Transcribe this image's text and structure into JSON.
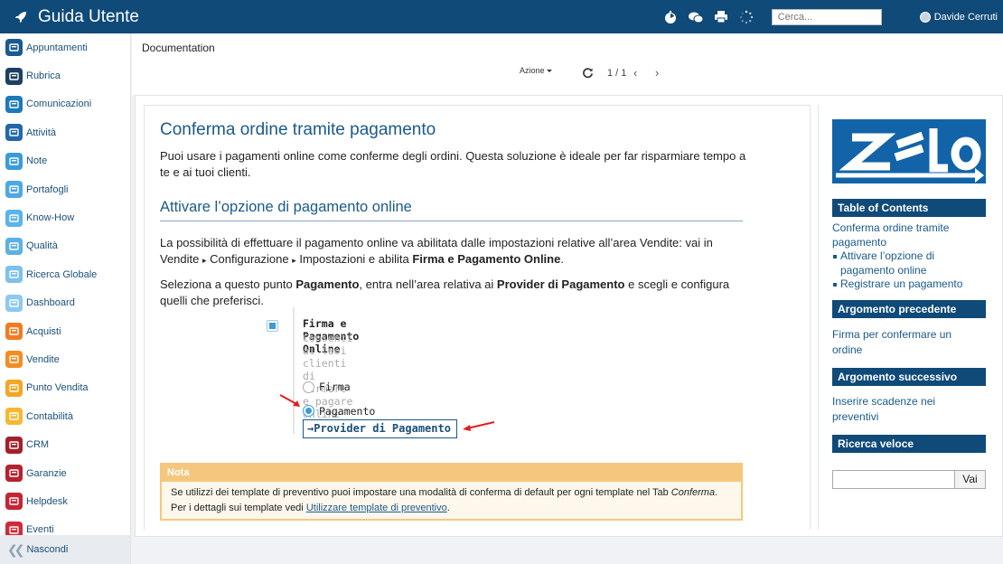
{
  "app": {
    "title": "Guida Utente"
  },
  "topbar": {
    "search_placeholder": "Cerca...",
    "user_name": "Davide Cerruti"
  },
  "sidebar": {
    "items": [
      {
        "label": "Appuntamenti",
        "color": "#1b5a8f"
      },
      {
        "label": "Rubrica",
        "color": "#1d3f63"
      },
      {
        "label": "Comunicazioni",
        "color": "#1c7ab8"
      },
      {
        "label": "Attività",
        "color": "#2268a8"
      },
      {
        "label": "Note",
        "color": "#3a9bd9"
      },
      {
        "label": "Portafogli",
        "color": "#4ea8e3"
      },
      {
        "label": "Know-How",
        "color": "#5bb3ea"
      },
      {
        "label": "Qualità",
        "color": "#5cb0e3"
      },
      {
        "label": "Ricerca Globale",
        "color": "#7cc0ec"
      },
      {
        "label": "Dashboard",
        "color": "#8dc9ef"
      },
      {
        "label": "Acquisti",
        "color": "#f27b21"
      },
      {
        "label": "Vendite",
        "color": "#f28d22"
      },
      {
        "label": "Punto Vendita",
        "color": "#f5a623"
      },
      {
        "label": "Contabilità",
        "color": "#f7b733"
      },
      {
        "label": "CRM",
        "color": "#a3202a"
      },
      {
        "label": "Garanzie",
        "color": "#b52230"
      },
      {
        "label": "Helpdesk",
        "color": "#c62434"
      },
      {
        "label": "Eventi",
        "color": "#d02a38"
      }
    ],
    "collapse_label": "Nascondi"
  },
  "header": {
    "title": "Documentation",
    "action_label": "Azione",
    "pager": "1 / 1"
  },
  "article": {
    "title": "Conferma ordine tramite pagamento",
    "intro": "Puoi usare i pagamenti online come conferme degli ordini. Questa soluzione è ideale per far risparmiare tempo a te e ai tuoi clienti.",
    "section_title": "Attivare l’opzione di pagamento online",
    "para1_a": "La possibilità di effettuare il pagamento online va abilitata dalle impostazioni relative all’area Vendite: vai in Vendite ",
    "para1_sep": "▸",
    "para1_b": " Configurazione ",
    "para1_c": " Impostazioni e abilita ",
    "para1_bold": "Firma e Pagamento Online",
    "para1_end": ".",
    "para2_a": "Seleziona a questo punto ",
    "para2_b1": "Pagamento",
    "para2_c": ", entra nell’area relativa ai ",
    "para2_b2": "Provider di Pagamento",
    "para2_d": " e scegli e configura quelli che preferisci.",
    "screenshot": {
      "option_title": "Firma e Pagamento Online",
      "option_subtitle": "Consenti ai tuoi clienti di firmare e pagare online",
      "radio_firma": "Firma",
      "radio_pagamento": "Pagamento",
      "provider_link": "→Provider di Pagamento"
    },
    "note": {
      "heading": "Nota",
      "line1_a": "Se utilizzi dei template di preventivo puoi impostare una modalità di conferma di default per ogni template nel Tab ",
      "line1_italic": "Conferma",
      "line1_end": ".",
      "line2_a": "Per i dettagli sui template vedi ",
      "line2_link": "Utilizzare template di preventivo",
      "line2_end": "."
    }
  },
  "toc": {
    "heading": "Table of Contents",
    "main_link": "Conferma ordine tramite pagamento",
    "sub_links": [
      "Attivare l’opzione di pagamento online",
      "Registrare un pagamento"
    ],
    "prev_heading": "Argomento precedente",
    "prev_link": "Firma per confermare un ordine",
    "next_heading": "Argomento successivo",
    "next_link": "Inserire scadenze nei preventivi",
    "search_heading": "Ricerca veloce",
    "search_button": "Vai"
  },
  "colors": {
    "brand": "#0f4a78",
    "accent": "#1a5a8a",
    "note": "#f5c77e",
    "arrow": "#e02020"
  }
}
